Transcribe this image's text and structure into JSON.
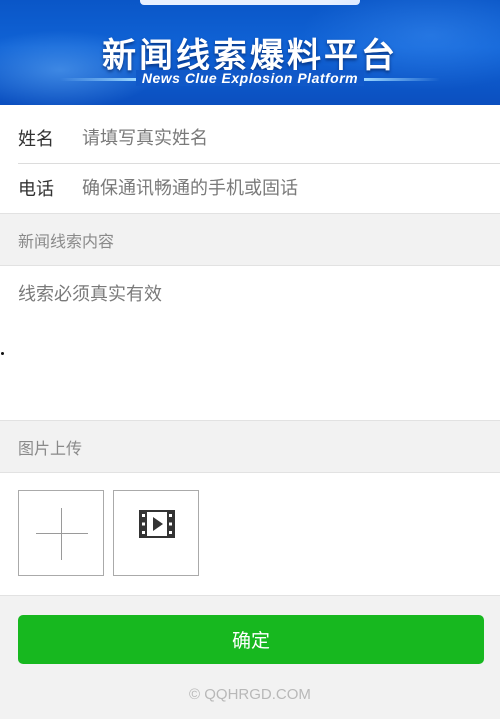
{
  "banner": {
    "title_cn": "新闻线索爆料平台",
    "title_en": "News Clue Explosion Platform"
  },
  "form": {
    "name": {
      "label": "姓名",
      "placeholder": "请填写真实姓名",
      "value": ""
    },
    "phone": {
      "label": "电话",
      "placeholder": "确保通讯畅通的手机或固话",
      "value": ""
    },
    "content_section_title": "新闻线索内容",
    "content": {
      "placeholder": "线索必须真实有效",
      "value": ""
    },
    "upload_section_title": "图片上传",
    "upload_buttons": [
      {
        "icon": "plus-icon"
      },
      {
        "icon": "video-icon"
      }
    ],
    "submit_label": "确定"
  },
  "footer": {
    "copyright": "© QQHRGD.COM"
  },
  "colors": {
    "banner_blue": "#0a56c7",
    "button_green": "#17b81f",
    "section_gray": "#f2f2f2"
  }
}
